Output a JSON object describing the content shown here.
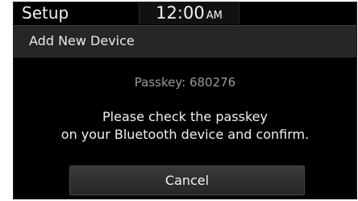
{
  "status_bar": {
    "app_title": "Setup",
    "clock": {
      "time": "12:00",
      "period": "AM"
    }
  },
  "header": {
    "title": "Add New Device"
  },
  "dialog": {
    "passkey_text": "Passkey: 680276",
    "message_line1": "Please check the passkey",
    "message_line2": "on your Bluetooth device and confirm."
  },
  "actions": {
    "cancel_label": "Cancel"
  }
}
